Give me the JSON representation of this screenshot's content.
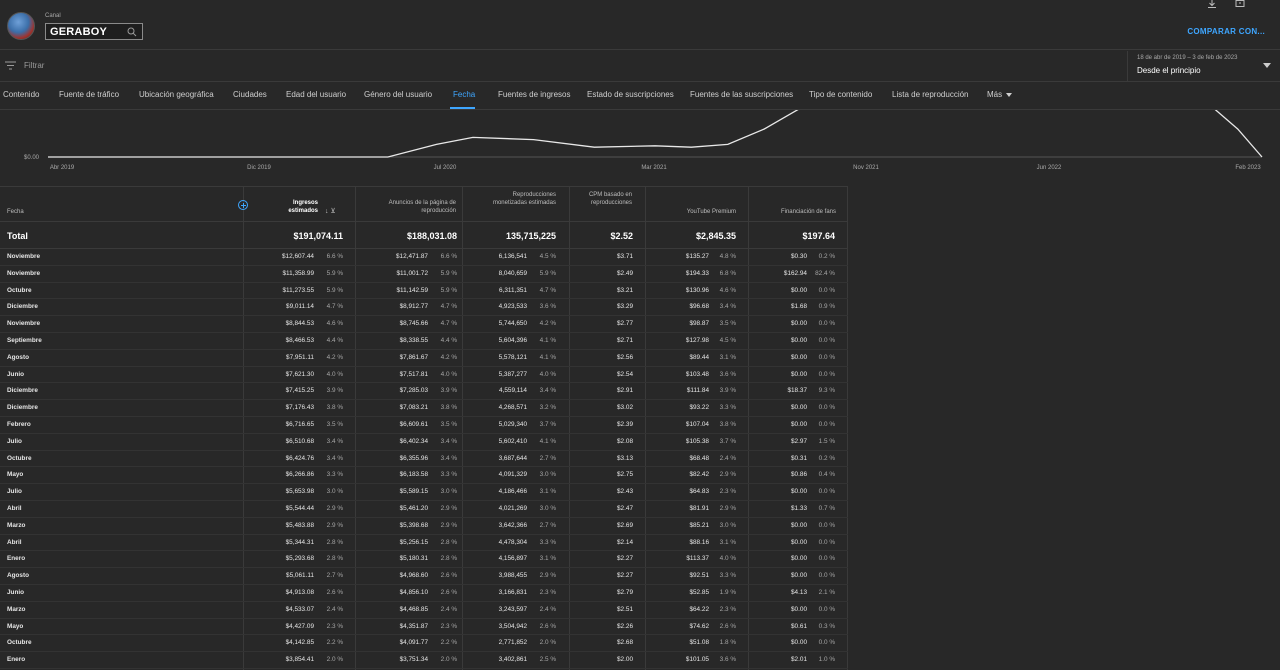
{
  "header": {
    "canal_label": "Canal",
    "channel_name": "GERABOY",
    "compare_label": "COMPARAR CON..."
  },
  "filter": {
    "placeholder": "Filtrar"
  },
  "date": {
    "range": "18 de abr de 2019 – 3 de feb de 2023",
    "preset": "Desde el principio"
  },
  "tabs": [
    "Contenido",
    "Fuente de tráfico",
    "Ubicación geográfica",
    "Ciudades",
    "Edad del usuario",
    "Género del usuario",
    "Fecha",
    "Fuentes de ingresos",
    "Estado de suscripciones",
    "Fuentes de las suscripciones",
    "Tipo de contenido",
    "Lista de reproducción",
    "Más"
  ],
  "active_tab": "Fecha",
  "chart_data": {
    "type": "line",
    "y_label_min": "$0.00",
    "x_ticks": [
      "Abr 2019",
      "Dic 2019",
      "Jul 2020",
      "Mar 2021",
      "Nov 2021",
      "Jun 2022",
      "Feb 2023"
    ],
    "points": [
      [
        0.0,
        0.0
      ],
      [
        0.28,
        0.0
      ],
      [
        0.32,
        0.45
      ],
      [
        0.35,
        0.7
      ],
      [
        0.4,
        0.62
      ],
      [
        0.45,
        0.35
      ],
      [
        0.5,
        0.4
      ],
      [
        0.53,
        0.35
      ],
      [
        0.56,
        0.45
      ],
      [
        0.59,
        1.0
      ],
      [
        0.62,
        1.8
      ],
      [
        0.96,
        1.8
      ],
      [
        0.98,
        1.0
      ],
      [
        1.0,
        0.0
      ]
    ]
  },
  "table": {
    "headers": {
      "fecha": "Fecha",
      "ingresos": "Ingresos estimados",
      "anuncios": "Anuncios de la página de reproducción",
      "reproducciones": "Reproducciones monetizadas estimadas",
      "cpm": "CPM basado en reproducciones",
      "premium": "YouTube Premium",
      "fans": "Financiación de fans"
    },
    "total": {
      "label": "Total",
      "ingresos": "$191,074.11",
      "anuncios": "$188,031.08",
      "reproducciones": "135,715,225",
      "cpm": "$2.52",
      "premium": "$2,845.35",
      "fans": "$197.64"
    },
    "rows": [
      [
        "Noviembre",
        "$12,607.44",
        "6.6 %",
        "$12,471.87",
        "6.6 %",
        "6,136,541",
        "4.5 %",
        "$3.71",
        "$135.27",
        "4.8 %",
        "$0.30",
        "0.2 %"
      ],
      [
        "Noviembre",
        "$11,358.99",
        "5.9 %",
        "$11,001.72",
        "5.9 %",
        "8,040,659",
        "5.9 %",
        "$2.49",
        "$194.33",
        "6.8 %",
        "$162.94",
        "82.4 %"
      ],
      [
        "Octubre",
        "$11,273.55",
        "5.9 %",
        "$11,142.59",
        "5.9 %",
        "6,311,351",
        "4.7 %",
        "$3.21",
        "$130.96",
        "4.6 %",
        "$0.00",
        "0.0 %"
      ],
      [
        "Diciembre",
        "$9,011.14",
        "4.7 %",
        "$8,912.77",
        "4.7 %",
        "4,923,533",
        "3.6 %",
        "$3.29",
        "$96.68",
        "3.4 %",
        "$1.68",
        "0.9 %"
      ],
      [
        "Noviembre",
        "$8,844.53",
        "4.6 %",
        "$8,745.66",
        "4.7 %",
        "5,744,650",
        "4.2 %",
        "$2.77",
        "$98.87",
        "3.5 %",
        "$0.00",
        "0.0 %"
      ],
      [
        "Septiembre",
        "$8,466.53",
        "4.4 %",
        "$8,338.55",
        "4.4 %",
        "5,604,396",
        "4.1 %",
        "$2.71",
        "$127.98",
        "4.5 %",
        "$0.00",
        "0.0 %"
      ],
      [
        "Agosto",
        "$7,951.11",
        "4.2 %",
        "$7,861.67",
        "4.2 %",
        "5,578,121",
        "4.1 %",
        "$2.56",
        "$89.44",
        "3.1 %",
        "$0.00",
        "0.0 %"
      ],
      [
        "Junio",
        "$7,621.30",
        "4.0 %",
        "$7,517.81",
        "4.0 %",
        "5,387,277",
        "4.0 %",
        "$2.54",
        "$103.48",
        "3.6 %",
        "$0.00",
        "0.0 %"
      ],
      [
        "Diciembre",
        "$7,415.25",
        "3.9 %",
        "$7,285.03",
        "3.9 %",
        "4,559,114",
        "3.4 %",
        "$2.91",
        "$111.84",
        "3.9 %",
        "$18.37",
        "9.3 %"
      ],
      [
        "Diciembre",
        "$7,176.43",
        "3.8 %",
        "$7,083.21",
        "3.8 %",
        "4,268,571",
        "3.2 %",
        "$3.02",
        "$93.22",
        "3.3 %",
        "$0.00",
        "0.0 %"
      ],
      [
        "Febrero",
        "$6,716.65",
        "3.5 %",
        "$6,609.61",
        "3.5 %",
        "5,029,340",
        "3.7 %",
        "$2.39",
        "$107.04",
        "3.8 %",
        "$0.00",
        "0.0 %"
      ],
      [
        "Julio",
        "$6,510.68",
        "3.4 %",
        "$6,402.34",
        "3.4 %",
        "5,602,410",
        "4.1 %",
        "$2.08",
        "$105.38",
        "3.7 %",
        "$2.97",
        "1.5 %"
      ],
      [
        "Octubre",
        "$6,424.76",
        "3.4 %",
        "$6,355.96",
        "3.4 %",
        "3,687,644",
        "2.7 %",
        "$3.13",
        "$68.48",
        "2.4 %",
        "$0.31",
        "0.2 %"
      ],
      [
        "Mayo",
        "$6,266.86",
        "3.3 %",
        "$6,183.58",
        "3.3 %",
        "4,091,329",
        "3.0 %",
        "$2.75",
        "$82.42",
        "2.9 %",
        "$0.86",
        "0.4 %"
      ],
      [
        "Julio",
        "$5,653.98",
        "3.0 %",
        "$5,589.15",
        "3.0 %",
        "4,186,466",
        "3.1 %",
        "$2.43",
        "$64.83",
        "2.3 %",
        "$0.00",
        "0.0 %"
      ],
      [
        "Abril",
        "$5,544.44",
        "2.9 %",
        "$5,461.20",
        "2.9 %",
        "4,021,269",
        "3.0 %",
        "$2.47",
        "$81.91",
        "2.9 %",
        "$1.33",
        "0.7 %"
      ],
      [
        "Marzo",
        "$5,483.88",
        "2.9 %",
        "$5,398.68",
        "2.9 %",
        "3,642,366",
        "2.7 %",
        "$2.69",
        "$85.21",
        "3.0 %",
        "$0.00",
        "0.0 %"
      ],
      [
        "Abril",
        "$5,344.31",
        "2.8 %",
        "$5,256.15",
        "2.8 %",
        "4,478,304",
        "3.3 %",
        "$2.14",
        "$88.16",
        "3.1 %",
        "$0.00",
        "0.0 %"
      ],
      [
        "Enero",
        "$5,293.68",
        "2.8 %",
        "$5,180.31",
        "2.8 %",
        "4,156,897",
        "3.1 %",
        "$2.27",
        "$113.37",
        "4.0 %",
        "$0.00",
        "0.0 %"
      ],
      [
        "Agosto",
        "$5,061.11",
        "2.7 %",
        "$4,968.60",
        "2.6 %",
        "3,988,455",
        "2.9 %",
        "$2.27",
        "$92.51",
        "3.3 %",
        "$0.00",
        "0.0 %"
      ],
      [
        "Junio",
        "$4,913.08",
        "2.6 %",
        "$4,856.10",
        "2.6 %",
        "3,166,831",
        "2.3 %",
        "$2.79",
        "$52.85",
        "1.9 %",
        "$4.13",
        "2.1 %"
      ],
      [
        "Marzo",
        "$4,533.07",
        "2.4 %",
        "$4,468.85",
        "2.4 %",
        "3,243,597",
        "2.4 %",
        "$2.51",
        "$64.22",
        "2.3 %",
        "$0.00",
        "0.0 %"
      ],
      [
        "Mayo",
        "$4,427.09",
        "2.3 %",
        "$4,351.87",
        "2.3 %",
        "3,504,942",
        "2.6 %",
        "$2.26",
        "$74.62",
        "2.6 %",
        "$0.61",
        "0.3 %"
      ],
      [
        "Octubre",
        "$4,142.85",
        "2.2 %",
        "$4,091.77",
        "2.2 %",
        "2,771,852",
        "2.0 %",
        "$2.68",
        "$51.08",
        "1.8 %",
        "$0.00",
        "0.0 %"
      ],
      [
        "Enero",
        "$3,854.41",
        "2.0 %",
        "$3,751.34",
        "2.0 %",
        "3,402,861",
        "2.5 %",
        "$2.00",
        "$101.05",
        "3.6 %",
        "$2.01",
        "1.0 %"
      ]
    ]
  },
  "colors": {
    "accent": "#3ea6ff",
    "background": "#282828"
  }
}
